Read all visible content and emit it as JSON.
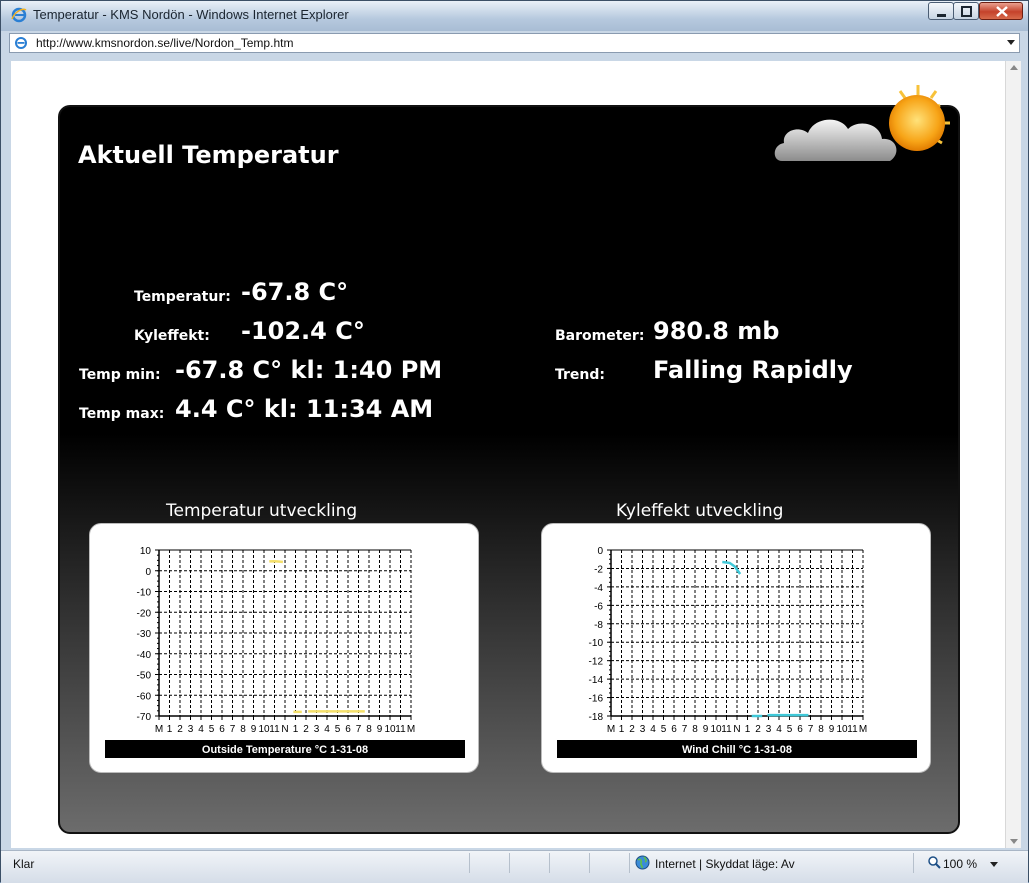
{
  "window": {
    "title": "Temperatur - KMS Nordön - Windows Internet Explorer",
    "url": "http://www.kmsnordon.se/live/Nordon_Temp.htm"
  },
  "page": {
    "heading": "Aktuell Temperatur",
    "temperature": {
      "label": "Temperatur:",
      "value": "-67.8 C°"
    },
    "wind_chill": {
      "label": "Kyleffekt:",
      "value": "-102.4 C°"
    },
    "temp_min": {
      "label": "Temp min:",
      "value": "-67.8 C° kl: 1:40 PM"
    },
    "temp_max": {
      "label": "Temp max:",
      "value": "4.4 C° kl: 11:34 AM"
    },
    "barometer": {
      "label": "Barometer:",
      "value": "980.8 mb"
    },
    "trend": {
      "label": "Trend:",
      "value": "Falling Rapidly"
    },
    "chart1_title": "Temperatur utveckling",
    "chart2_title": "Kyleffekt utveckling"
  },
  "status": {
    "text": "Klar",
    "zone": "Internet | Skyddat läge: Av",
    "zoom": "100 %"
  },
  "chart_data": [
    {
      "type": "line",
      "title": "Temperatur utveckling",
      "footer": "Outside Temperature   °C     1-31-08",
      "xlabels": [
        "M",
        "1",
        "2",
        "3",
        "4",
        "5",
        "6",
        "7",
        "8",
        "9",
        "10",
        "11",
        "N",
        "1",
        "2",
        "3",
        "4",
        "5",
        "6",
        "7",
        "8",
        "9",
        "10",
        "11",
        "M"
      ],
      "ylim": [
        -70,
        10
      ],
      "yticks": [
        10,
        0,
        -10,
        -20,
        -30,
        -40,
        -50,
        -60,
        -70
      ],
      "color": "#f5e06a",
      "series": [
        {
          "x": [
            10.5,
            11,
            11.5,
            11.8
          ],
          "y": [
            4.5,
            4.6,
            4.4,
            4.2
          ]
        },
        {
          "x": [
            12.8,
            13.6
          ],
          "y": [
            -68,
            -68
          ]
        },
        {
          "x": [
            14.2,
            19.6
          ],
          "y": [
            -67.8,
            -67.8
          ]
        }
      ]
    },
    {
      "type": "line",
      "title": "Kyleffekt utveckling",
      "footer": "Wind Chill   °C     1-31-08",
      "xlabels": [
        "M",
        "1",
        "2",
        "3",
        "4",
        "5",
        "6",
        "7",
        "8",
        "9",
        "10",
        "11",
        "N",
        "1",
        "2",
        "3",
        "4",
        "5",
        "6",
        "7",
        "8",
        "9",
        "10",
        "11",
        "M"
      ],
      "ylim": [
        -18,
        0
      ],
      "yticks": [
        0,
        -2,
        -4,
        -6,
        -8,
        -10,
        -12,
        -14,
        -16,
        -18
      ],
      "color": "#3fc8d8",
      "series": [
        {
          "x": [
            10.6,
            11.3,
            11.8,
            12.3
          ],
          "y": [
            -1.3,
            -1.4,
            -1.8,
            -2.6
          ]
        },
        {
          "x": [
            13.4,
            14.4
          ],
          "y": [
            -18,
            -18
          ]
        },
        {
          "x": [
            14.9,
            18.8
          ],
          "y": [
            -17.9,
            -17.9
          ]
        }
      ]
    }
  ]
}
